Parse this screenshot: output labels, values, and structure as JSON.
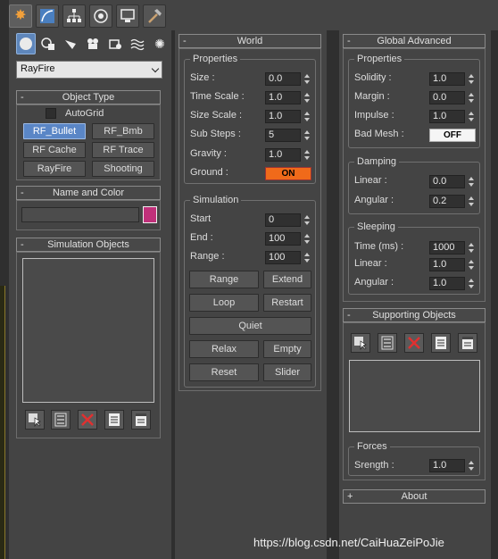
{
  "left_panel": {
    "tab_icons": [
      "create-icon",
      "modify-icon",
      "hierarchy-icon",
      "motion-icon",
      "display-icon",
      "utilities-icon"
    ],
    "category_icons": [
      "geometry-icon",
      "shapes-icon",
      "lights-icon",
      "cameras-icon",
      "helpers-icon",
      "spacewarps-icon",
      "systems-icon"
    ],
    "dropdown_value": "RayFire",
    "object_type": {
      "title": "Object Type",
      "autogrid": "AutoGrid",
      "buttons": [
        "RF_Bullet",
        "RF_Bmb",
        "RF Cache",
        "RF Trace",
        "RayFire",
        "Shooting"
      ]
    },
    "name_color": {
      "title": "Name and Color",
      "swatch": "#c0307a"
    },
    "simulation_objects": {
      "title": "Simulation Objects"
    }
  },
  "world": {
    "title": "World",
    "properties_title": "Properties",
    "props": [
      {
        "label": "Size :",
        "value": "0.0"
      },
      {
        "label": "Time Scale :",
        "value": "1.0"
      },
      {
        "label": "Size Scale :",
        "value": "1.0"
      },
      {
        "label": "Sub Steps :",
        "value": "5"
      },
      {
        "label": "Gravity :",
        "value": "1.0"
      }
    ],
    "ground_label": "Ground :",
    "ground_toggle": "ON",
    "simulation_title": "Simulation",
    "sim": [
      {
        "label": "Start",
        "value": "0"
      },
      {
        "label": "End :",
        "value": "100"
      },
      {
        "label": "Range :",
        "value": "100"
      }
    ],
    "buttons": {
      "range": "Range",
      "extend": "Extend",
      "loop": "Loop",
      "restart": "Restart",
      "quiet": "Quiet",
      "relax": "Relax",
      "empty": "Empty",
      "reset": "Reset",
      "slider": "Slider"
    }
  },
  "global_advanced": {
    "title": "Global Advanced",
    "properties_title": "Properties",
    "props": [
      {
        "label": "Solidity :",
        "value": "1.0"
      },
      {
        "label": "Margin :",
        "value": "0.0"
      },
      {
        "label": "Impulse :",
        "value": "1.0"
      }
    ],
    "bad_mesh_label": "Bad Mesh :",
    "bad_mesh_toggle": "OFF",
    "damping_title": "Damping",
    "damping": [
      {
        "label": "Linear :",
        "value": "0.0"
      },
      {
        "label": "Angular :",
        "value": "0.2"
      }
    ],
    "sleeping_title": "Sleeping",
    "sleeping": [
      {
        "label": "Time (ms) :",
        "value": "1000"
      },
      {
        "label": "Linear :",
        "value": "1.0"
      },
      {
        "label": "Angular :",
        "value": "1.0"
      }
    ]
  },
  "supporting_objects": {
    "title": "Supporting Objects",
    "forces_title": "Forces",
    "strength_label": "Srength :",
    "strength_value": "1.0"
  },
  "about": {
    "title": "About",
    "sign": "+"
  },
  "watermark": "https://blog.csdn.net/CaiHuaZeiPoJie"
}
